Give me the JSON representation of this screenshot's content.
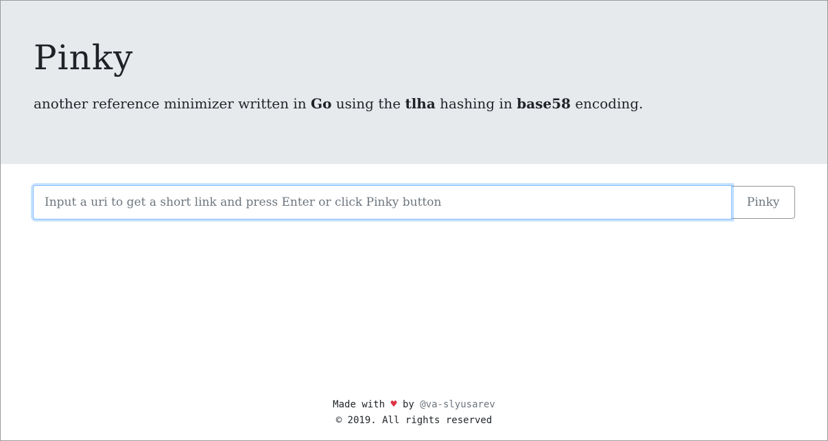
{
  "header": {
    "title": "Pinky",
    "subtitle": {
      "prefix": "another reference minimizer written in ",
      "lang": "Go",
      "middle1": " using the ",
      "hash": "tlha",
      "middle2": " hashing in ",
      "encoding": "base58",
      "suffix": " encoding."
    }
  },
  "form": {
    "uri_placeholder": "Input a uri to get a short link and press Enter or click Pinky button",
    "uri_value": "",
    "submit_label": "Pinky"
  },
  "footer": {
    "made_with": "Made with",
    "heart_icon": "heart-icon",
    "by": "by",
    "author": "@va-slyusarev",
    "copyright": "© 2019. All rights reserved"
  },
  "colors": {
    "header_bg": "#e7eaed",
    "heart": "#dc3545",
    "focus_border": "#80bdff"
  }
}
